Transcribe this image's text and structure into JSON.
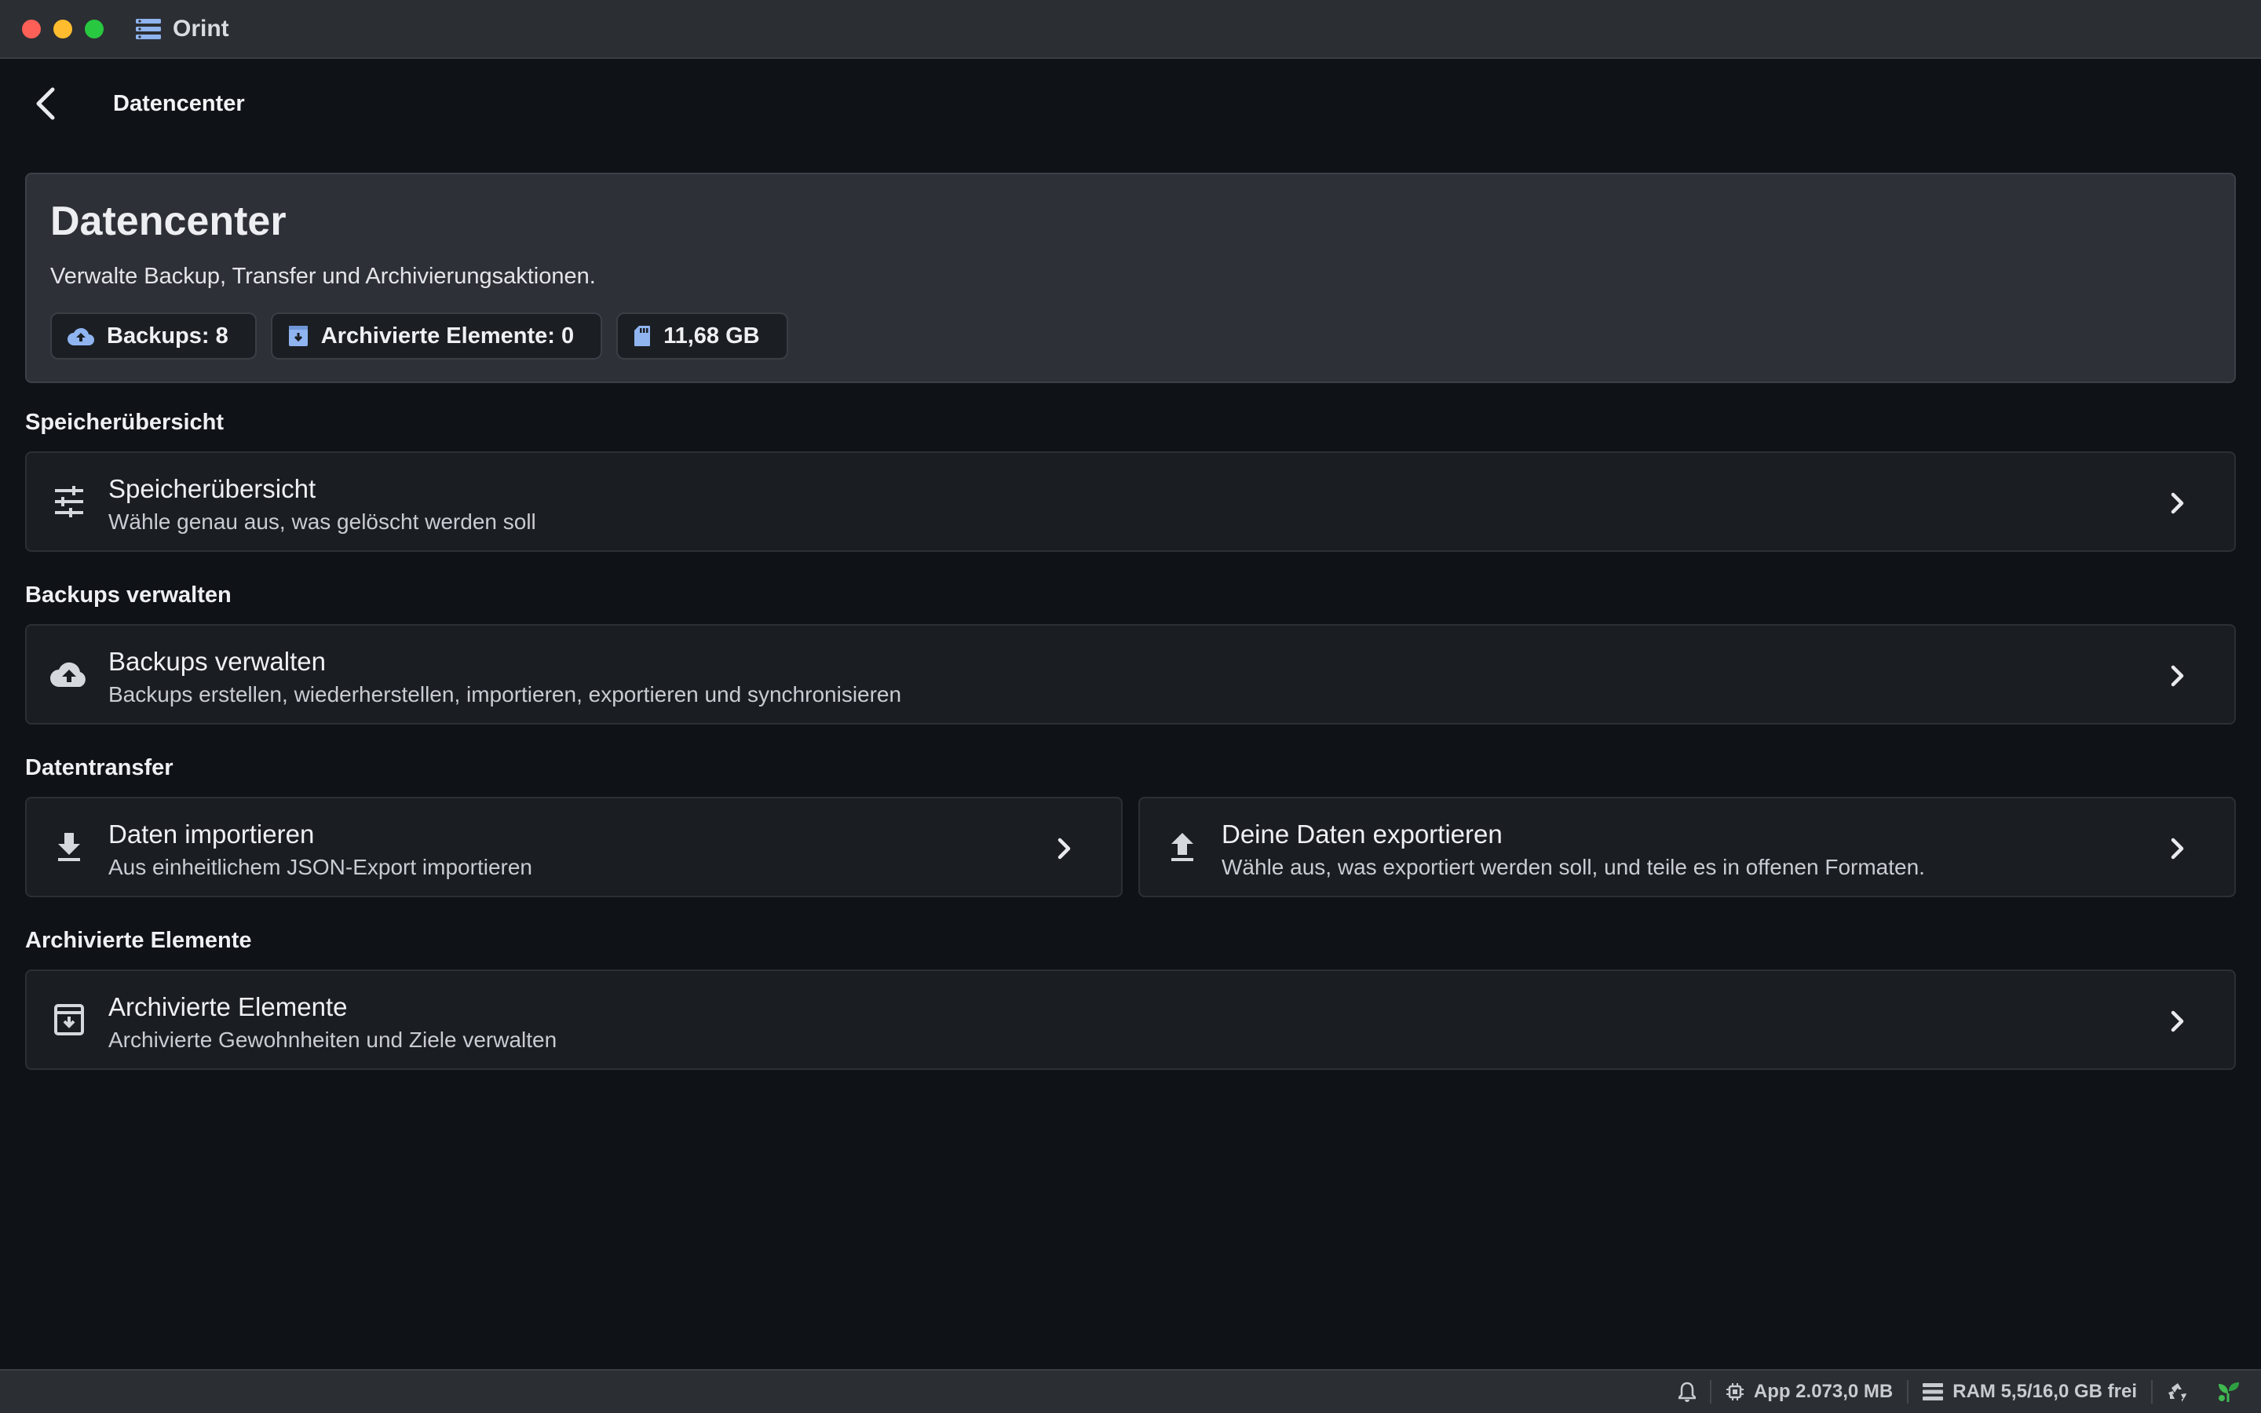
{
  "window": {
    "app_title": "Orint"
  },
  "topbar": {
    "title": "Datencenter"
  },
  "hero": {
    "title": "Datencenter",
    "subtitle": "Verwalte Backup, Transfer und Archivierungsaktionen.",
    "chips": [
      {
        "label": "Backups: 8",
        "icon": "cloud-upload-icon"
      },
      {
        "label": "Archivierte Elemente: 0",
        "icon": "archive-icon"
      },
      {
        "label": "11,68 GB",
        "icon": "sd-card-icon"
      }
    ]
  },
  "sections": {
    "storage": {
      "label": "Speicherübersicht",
      "card": {
        "title": "Speicherübersicht",
        "subtitle": "Wähle genau aus, was gelöscht werden soll",
        "icon": "tune-icon"
      }
    },
    "backups": {
      "label": "Backups verwalten",
      "card": {
        "title": "Backups verwalten",
        "subtitle": "Backups erstellen, wiederherstellen, importieren, exportieren und synchronisieren",
        "icon": "cloud-upload-icon"
      }
    },
    "transfer": {
      "label": "Datentransfer",
      "import": {
        "title": "Daten importieren",
        "subtitle": "Aus einheitlichem JSON-Export importieren",
        "icon": "download-icon"
      },
      "export": {
        "title": "Deine Daten exportieren",
        "subtitle": "Wähle aus, was exportiert werden soll, und teile es in offenen Formaten.",
        "icon": "upload-icon"
      }
    },
    "archived": {
      "label": "Archivierte Elemente",
      "card": {
        "title": "Archivierte Elemente",
        "subtitle": "Archivierte Gewohnheiten und Ziele verwalten",
        "icon": "archive-box-icon"
      }
    }
  },
  "statusbar": {
    "app_memory": "App 2.073,0 MB",
    "ram": "RAM 5,5/16,0 GB frei"
  },
  "colors": {
    "accent": "#8fb4f0",
    "background": "#0f1217",
    "card": "#1a1d22",
    "hero": "#2d3036",
    "status_green": "#3fb950"
  }
}
